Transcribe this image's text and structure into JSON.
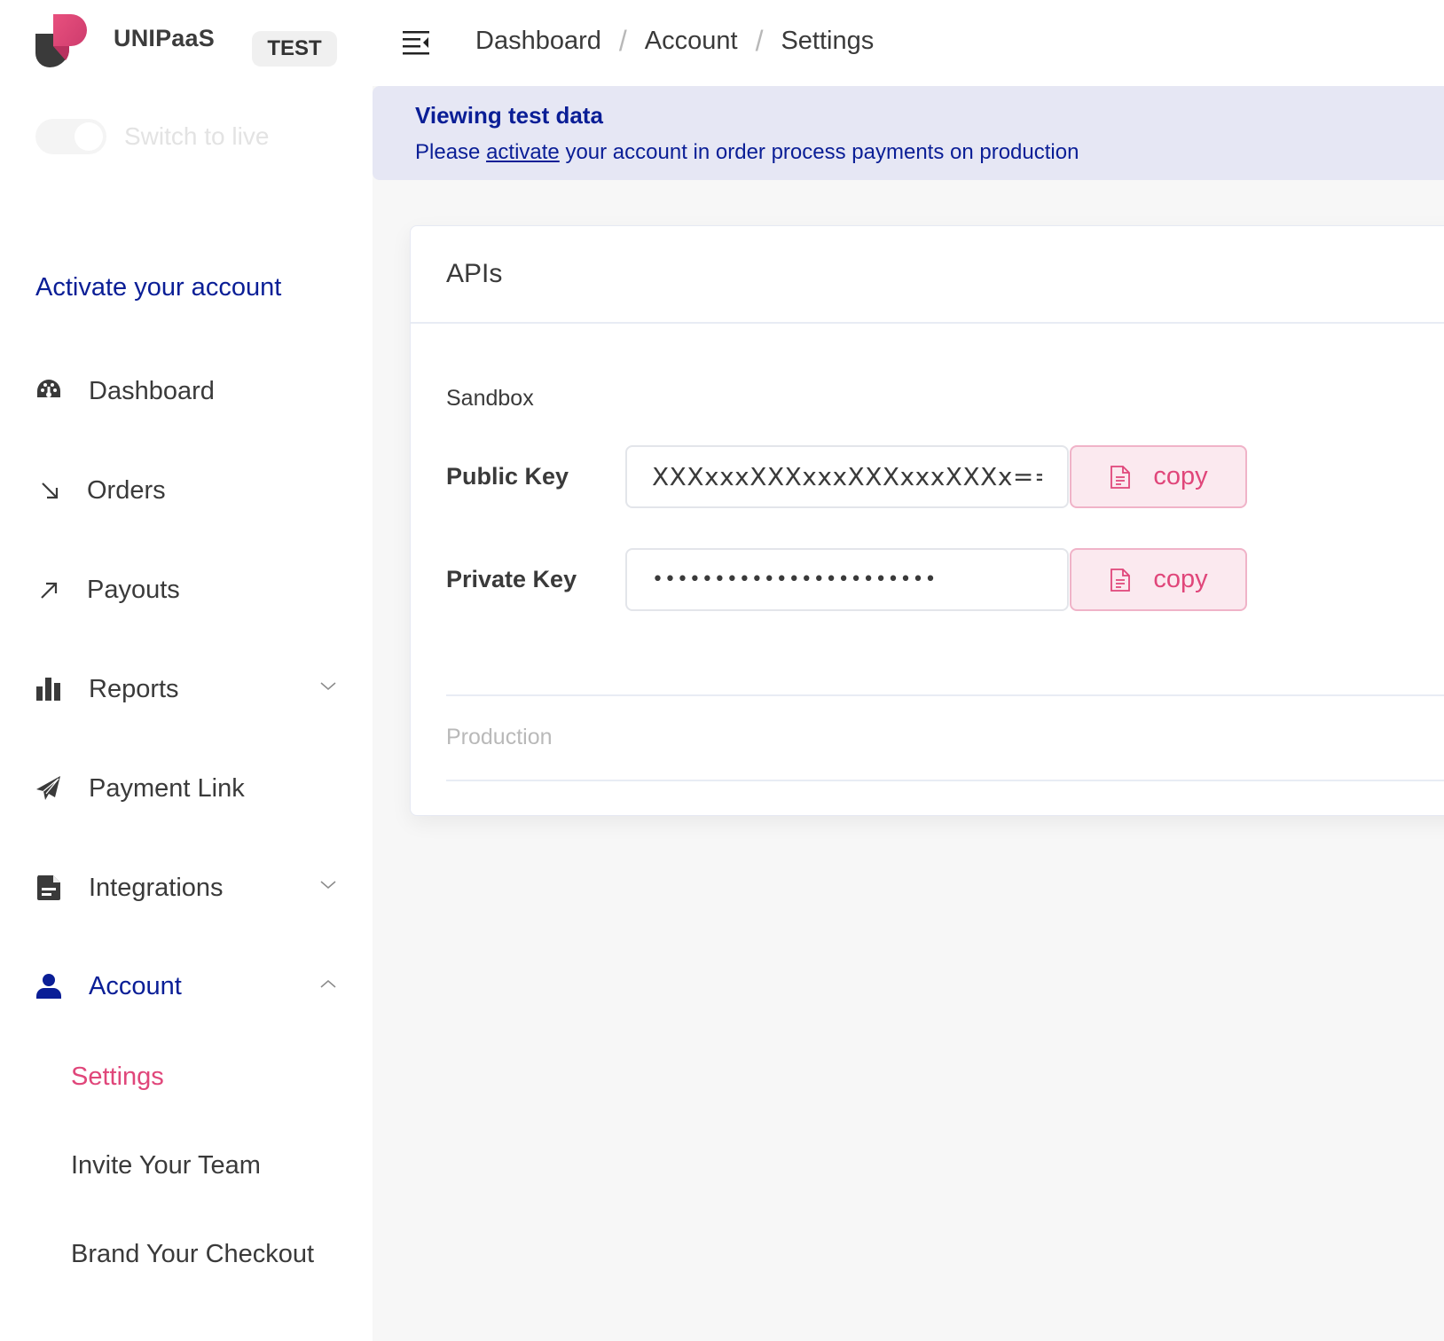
{
  "brand": {
    "name": "UNIPaaS",
    "env_badge": "TEST",
    "switch_label": "Switch to live",
    "switch_on": false,
    "logo_colors": {
      "primary": "#e0467a",
      "secondary": "#3a3a3a"
    }
  },
  "sidebar": {
    "activate_link": "Activate your account",
    "items": [
      {
        "label": "Dashboard",
        "icon": "tachometer-icon",
        "expandable": false
      },
      {
        "label": "Orders",
        "icon": "arrow-down-right-icon",
        "expandable": false
      },
      {
        "label": "Payouts",
        "icon": "arrow-up-right-icon",
        "expandable": false
      },
      {
        "label": "Reports",
        "icon": "bar-chart-icon",
        "expandable": true,
        "expanded": false
      },
      {
        "label": "Payment Link",
        "icon": "paper-plane-icon",
        "expandable": true,
        "expanded": false
      },
      {
        "label": "Integrations",
        "icon": "document-icon",
        "expandable": true,
        "expanded": false
      },
      {
        "label": "Account",
        "icon": "user-icon",
        "expandable": true,
        "expanded": true,
        "active": true
      }
    ],
    "account_subitems": [
      {
        "label": "Settings",
        "active": true
      },
      {
        "label": "Invite Your Team",
        "active": false
      },
      {
        "label": "Brand Your Checkout",
        "active": false
      }
    ]
  },
  "header": {
    "menu_icon": "menu-collapse-icon",
    "breadcrumb": [
      "Dashboard",
      "Account",
      "Settings"
    ],
    "separator": "/"
  },
  "banner": {
    "title": "Viewing test data",
    "text_before": "Please ",
    "link": "activate",
    "text_after": " your account in order process payments on production"
  },
  "card": {
    "title": "APIs",
    "sandbox": {
      "label": "Sandbox",
      "public_key": {
        "label": "Public Key",
        "value": "XXXxxxXXXxxxXXXxxxXXXx==",
        "copy_label": "copy"
      },
      "private_key": {
        "label": "Private Key",
        "value": "•••••••••••••••••••••••",
        "copy_label": "copy"
      }
    },
    "production": {
      "label": "Production"
    }
  },
  "colors": {
    "accent_blue": "#0a1e96",
    "accent_pink": "#e0467a",
    "banner_bg": "#e6e7f4",
    "copy_bg": "#fbe9ef",
    "copy_border": "#f0b3c8"
  }
}
